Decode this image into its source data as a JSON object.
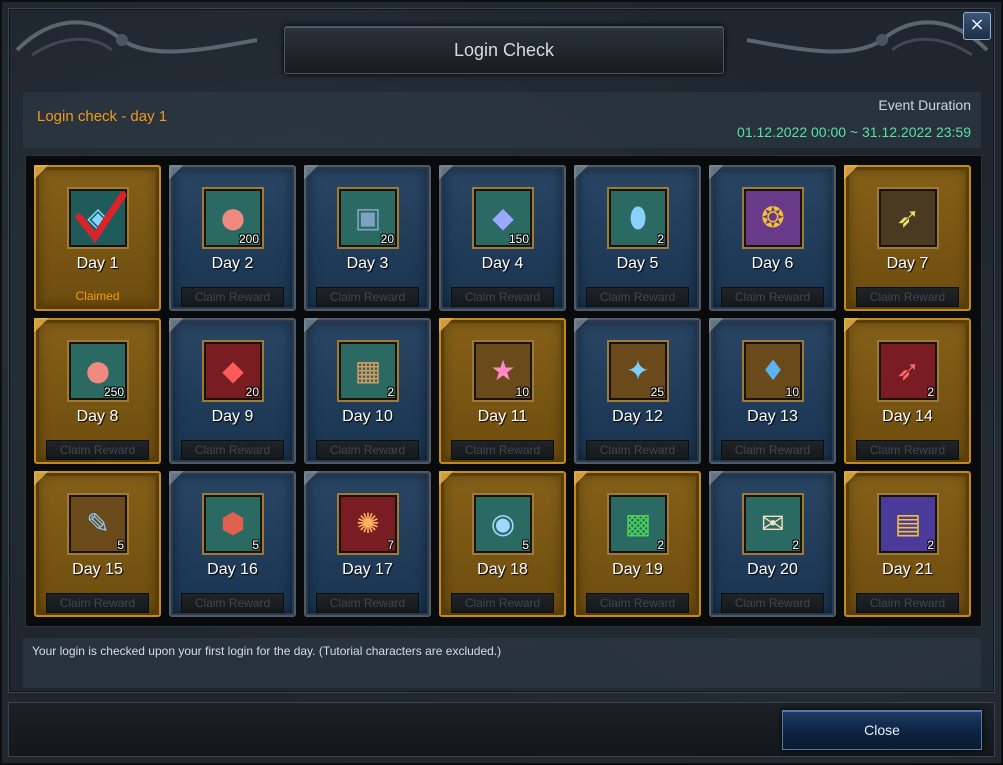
{
  "window": {
    "title": "Login Check",
    "close_icon": "×"
  },
  "header": {
    "status": "Login check - day 1",
    "duration_label": "Event Duration",
    "duration_range": "01.12.2022 00:00 ~ 31.12.2022 23:59"
  },
  "days": [
    {
      "label": "Day 1",
      "qty": "",
      "icon": "orb-pendant-icon",
      "glyph": "◈",
      "icon_bg": "#1e5b5a",
      "glyph_color": "#7fd7ff",
      "style": "gold",
      "claimed": true,
      "status_text": "Claimed"
    },
    {
      "label": "Day 2",
      "qty": "200",
      "icon": "coral-icon",
      "glyph": "●",
      "icon_bg": "#2b6a62",
      "glyph_color": "#f08a80",
      "style": "blue",
      "claimed": false,
      "status_text": "Claim Reward"
    },
    {
      "label": "Day 3",
      "qty": "20",
      "icon": "treasure-chest-icon",
      "glyph": "▣",
      "icon_bg": "#2b6a62",
      "glyph_color": "#7ea4c2",
      "style": "blue",
      "claimed": false,
      "status_text": "Claim Reward"
    },
    {
      "label": "Day 4",
      "qty": "150",
      "icon": "blue-crystal-icon",
      "glyph": "◆",
      "icon_bg": "#2b6a62",
      "glyph_color": "#9aa8ff",
      "style": "blue",
      "claimed": false,
      "status_text": "Claim Reward"
    },
    {
      "label": "Day 5",
      "qty": "2",
      "icon": "capsule-icon",
      "glyph": "⬮",
      "icon_bg": "#2b6a62",
      "glyph_color": "#8ad0ff",
      "style": "blue",
      "claimed": false,
      "status_text": "Claim Reward"
    },
    {
      "label": "Day 6",
      "qty": "",
      "icon": "gold-coins-icon",
      "glyph": "❂",
      "icon_bg": "#6a3a8a",
      "glyph_color": "#f2c232",
      "style": "blue",
      "claimed": false,
      "status_text": "Claim Reward"
    },
    {
      "label": "Day 7",
      "qty": "",
      "icon": "spear-tip-icon",
      "glyph": "➶",
      "icon_bg": "#4a3a22",
      "glyph_color": "#f0e070",
      "style": "gold",
      "claimed": false,
      "status_text": "Claim Reward"
    },
    {
      "label": "Day 8",
      "qty": "250",
      "icon": "coral-icon",
      "glyph": "●",
      "icon_bg": "#2b6a62",
      "glyph_color": "#f08a80",
      "style": "gold",
      "claimed": false,
      "status_text": "Claim Reward"
    },
    {
      "label": "Day 9",
      "qty": "20",
      "icon": "red-crystal-icon",
      "glyph": "◆",
      "icon_bg": "#7a1d22",
      "glyph_color": "#ff5a5a",
      "style": "blue",
      "claimed": false,
      "status_text": "Claim Reward"
    },
    {
      "label": "Day 10",
      "qty": "2",
      "icon": "gift-box-icon",
      "glyph": "▦",
      "icon_bg": "#2b6a62",
      "glyph_color": "#d89a60",
      "style": "blue",
      "claimed": false,
      "status_text": "Claim Reward"
    },
    {
      "label": "Day 11",
      "qty": "10",
      "icon": "star-icon",
      "glyph": "★",
      "icon_bg": "#6a4a1a",
      "glyph_color": "#ff8ac8",
      "style": "gold",
      "claimed": false,
      "status_text": "Claim Reward"
    },
    {
      "label": "Day 12",
      "qty": "25",
      "icon": "crystal-cluster-icon",
      "glyph": "✦",
      "icon_bg": "#6a4a1a",
      "glyph_color": "#7ad0ff",
      "style": "blue",
      "claimed": false,
      "status_text": "Claim Reward"
    },
    {
      "label": "Day 13",
      "qty": "10",
      "icon": "pouch-icon",
      "glyph": "♦",
      "icon_bg": "#6a4a1a",
      "glyph_color": "#5ab2f0",
      "style": "blue",
      "claimed": false,
      "status_text": "Claim Reward"
    },
    {
      "label": "Day 14",
      "qty": "2",
      "icon": "red-spear-tip-icon",
      "glyph": "➶",
      "icon_bg": "#7a1d22",
      "glyph_color": "#ff6a6a",
      "style": "gold",
      "claimed": false,
      "status_text": "Claim Reward"
    },
    {
      "label": "Day 15",
      "qty": "5",
      "icon": "feather-icon",
      "glyph": "✎",
      "icon_bg": "#6a4a1a",
      "glyph_color": "#8ad0ff",
      "style": "gold",
      "claimed": false,
      "status_text": "Claim Reward"
    },
    {
      "label": "Day 16",
      "qty": "5",
      "icon": "rune-stone-icon",
      "glyph": "⬢",
      "icon_bg": "#2b6a62",
      "glyph_color": "#e06050",
      "style": "blue",
      "claimed": false,
      "status_text": "Claim Reward"
    },
    {
      "label": "Day 17",
      "qty": "7",
      "icon": "fire-scroll-icon",
      "glyph": "✺",
      "icon_bg": "#7a1d22",
      "glyph_color": "#ffb060",
      "style": "blue",
      "claimed": false,
      "status_text": "Claim Reward"
    },
    {
      "label": "Day 18",
      "qty": "5",
      "icon": "blue-amulet-icon",
      "glyph": "◉",
      "icon_bg": "#2b6a62",
      "glyph_color": "#a0d8ff",
      "style": "gold",
      "claimed": false,
      "status_text": "Claim Reward"
    },
    {
      "label": "Day 19",
      "qty": "2",
      "icon": "green-gift-icon",
      "glyph": "▩",
      "icon_bg": "#2b6a62",
      "glyph_color": "#4ad05a",
      "style": "gold",
      "claimed": false,
      "status_text": "Claim Reward"
    },
    {
      "label": "Day 20",
      "qty": "2",
      "icon": "scroll-icon",
      "glyph": "✉",
      "icon_bg": "#2b6a62",
      "glyph_color": "#f0e0c0",
      "style": "blue",
      "claimed": false,
      "status_text": "Claim Reward"
    },
    {
      "label": "Day 21",
      "qty": "2",
      "icon": "card-icon",
      "glyph": "▤",
      "icon_bg": "#4a3a9a",
      "glyph_color": "#f0c040",
      "style": "gold",
      "claimed": false,
      "status_text": "Claim Reward"
    }
  ],
  "note": "Your login is checked upon your first login for the day. (Tutorial characters are excluded.)",
  "footer": {
    "close_label": "Close"
  }
}
